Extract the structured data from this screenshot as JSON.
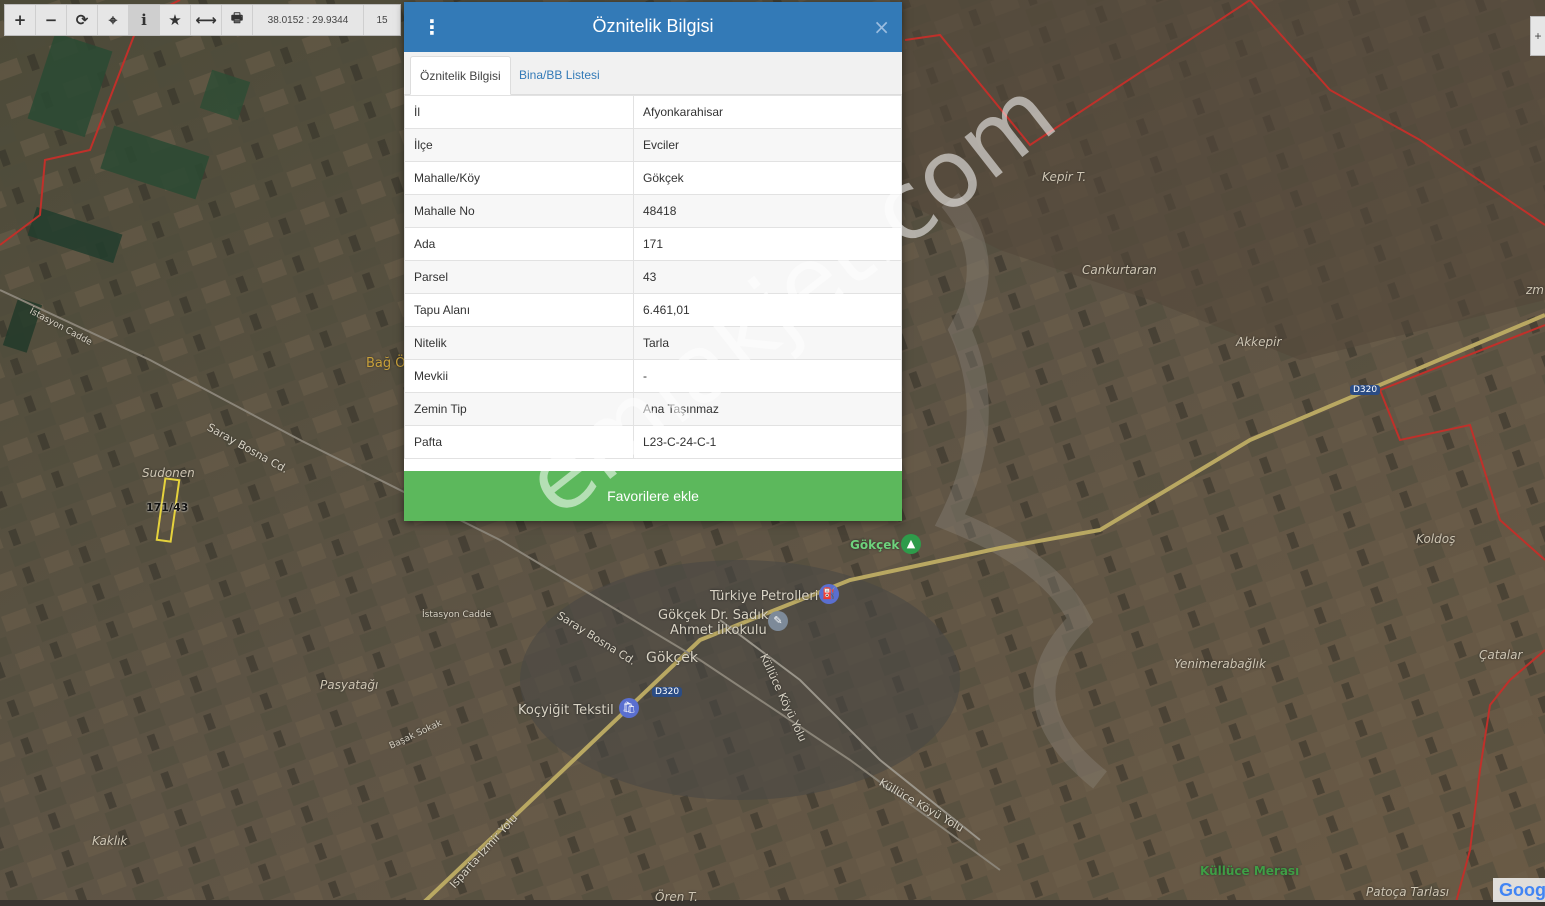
{
  "toolbar": {
    "buttons": [
      {
        "name": "zoom-in-icon",
        "glyph": "+"
      },
      {
        "name": "zoom-out-icon",
        "glyph": "−"
      },
      {
        "name": "refresh-icon",
        "glyph": "⟳"
      },
      {
        "name": "locate-icon",
        "glyph": "⌖"
      },
      {
        "name": "info-icon",
        "glyph": "i"
      },
      {
        "name": "star-icon",
        "glyph": "★"
      },
      {
        "name": "measure-icon",
        "glyph": "⟷"
      },
      {
        "name": "print-icon",
        "glyph": "🖶"
      }
    ],
    "coordinates": "38.0152 : 29.9344",
    "zoom": "15"
  },
  "dialog": {
    "title": "Öznitelik Bilgisi",
    "menu_glyph": "⋮",
    "close_glyph": "×",
    "tabs": [
      "Öznitelik Bilgisi",
      "Bina/BB Listesi"
    ],
    "rows": [
      {
        "key": "İl",
        "value": "Afyonkarahisar"
      },
      {
        "key": "İlçe",
        "value": "Evciler"
      },
      {
        "key": "Mahalle/Köy",
        "value": "Gökçek"
      },
      {
        "key": "Mahalle No",
        "value": "48418"
      },
      {
        "key": "Ada",
        "value": "171"
      },
      {
        "key": "Parsel",
        "value": "43"
      },
      {
        "key": "Tapu Alanı",
        "value": "6.461,01"
      },
      {
        "key": "Nitelik",
        "value": "Tarla"
      },
      {
        "key": "Mevkii",
        "value": "-"
      },
      {
        "key": "Zemin Tip",
        "value": "Ana Taşınmaz"
      },
      {
        "key": "Pafta",
        "value": "L23-C-24-C-1"
      }
    ],
    "favorite_button": "Favorilere ekle"
  },
  "map": {
    "parcel_label": "171/43",
    "labels": {
      "sudonen": "Sudonen",
      "bag": "Bağ Ö",
      "saray_bosna": "Saray Bosna Cd.",
      "saray_bosna2": "Saray Bosna Cd.",
      "istasyon": "İstasyon Cadde",
      "istasyon_top": "İstasyon Cadde",
      "pasyatagi": "Pasyatağı",
      "kaklik": "Kaklık",
      "gokcek_poi": "Gökçek",
      "gokcek_town": "Gökçek",
      "turkiye_petrolleri": "Türkiye Petrolleri",
      "gokcek_school": "Gökçek Dr. Sadık",
      "gokcek_school2": "Ahmet İlkokulu",
      "kocyigit": "Koçyiğit Tekstil",
      "kulluce_koyu": "Küllüce Köyü Yolu",
      "kulluce_koyu2": "Küllüce Köyü Yolu",
      "isparta_izmir": "Isparta-İzmir Yolu",
      "basak": "Başak Sokak",
      "d320": "D320",
      "d320b": "D320",
      "kepir": "Kepir T.",
      "cankurtaran": "Cankurtaran",
      "akkepir": "Akkepir",
      "koldos": "Koldoş",
      "yenimerabaglik": "Yenimerabağlık",
      "catalar": "Çatalar",
      "kulluce_merasi": "Küllüce Merası",
      "patoca": "Patoça Tarlası",
      "oren": "Ören T.",
      "zm": "zm"
    },
    "watermark": "emlakjet.com",
    "google": "Goog"
  }
}
